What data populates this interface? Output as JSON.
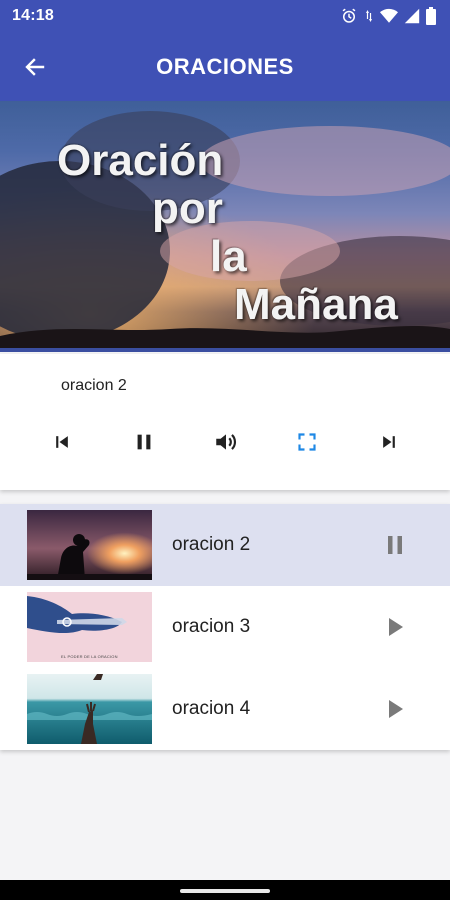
{
  "status_bar": {
    "time": "14:18",
    "icons": [
      "alarm-icon",
      "data-arrows-icon",
      "wifi-icon",
      "signal-icon",
      "battery-icon"
    ]
  },
  "app_bar": {
    "title": "ORACIONES",
    "back_icon": "arrow-left-icon",
    "color": "#3f51b5"
  },
  "hero": {
    "line1": "Oración",
    "line2": "por",
    "line3": "la",
    "line4": "Mañana"
  },
  "player": {
    "now_playing": "oracion 2",
    "controls": [
      "skip-previous-icon",
      "pause-icon",
      "volume-icon",
      "fullscreen-icon",
      "skip-next-icon"
    ],
    "accent_color": "#1e88e5"
  },
  "playlist": {
    "items": [
      {
        "name": "oracion 2",
        "state": "playing",
        "action_icon": "pause-icon"
      },
      {
        "name": "oracion 3",
        "state": "stopped",
        "action_icon": "play-icon",
        "thumb_caption": "EL PODER DE LA ORACION"
      },
      {
        "name": "oracion 4",
        "state": "stopped",
        "action_icon": "play-icon"
      }
    ],
    "active_row_color": "#dde0f0"
  }
}
